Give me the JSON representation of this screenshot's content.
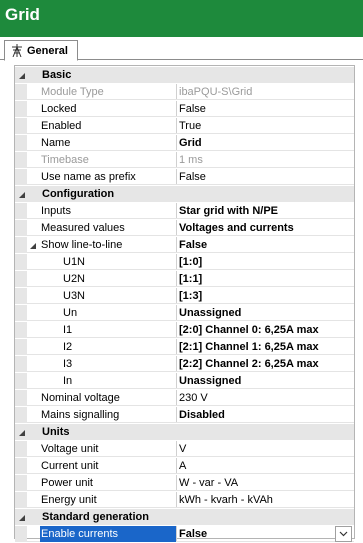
{
  "window": {
    "title": "Grid"
  },
  "tabs": [
    {
      "label": "General",
      "icon": "grid-tower-icon"
    }
  ],
  "categories": {
    "basic": "Basic",
    "configuration": "Configuration",
    "units": "Units",
    "standard_generation": "Standard generation"
  },
  "basic": {
    "module_type": {
      "name": "Module Type",
      "value": "ibaPQU-S\\Grid"
    },
    "locked": {
      "name": "Locked",
      "value": "False"
    },
    "enabled": {
      "name": "Enabled",
      "value": "True"
    },
    "name": {
      "name": "Name",
      "value": "Grid"
    },
    "timebase": {
      "name": "Timebase",
      "value": "1 ms"
    },
    "use_name_as_prefix": {
      "name": "Use name as prefix",
      "value": "False"
    }
  },
  "configuration": {
    "inputs": {
      "name": "Inputs",
      "value": "Star grid with N/PE"
    },
    "measured_values": {
      "name": "Measured values",
      "value": "Voltages and currents"
    },
    "show_line_to_line": {
      "name": "Show line-to-line",
      "value": "False"
    },
    "u1n": {
      "name": "U1N",
      "value": "[1:0]"
    },
    "u2n": {
      "name": "U2N",
      "value": "[1:1]"
    },
    "u3n": {
      "name": "U3N",
      "value": "[1:3]"
    },
    "un": {
      "name": "Un",
      "value": "Unassigned"
    },
    "i1": {
      "name": "I1",
      "value": "[2:0] Channel  0: 6,25A max"
    },
    "i2": {
      "name": "I2",
      "value": "[2:1] Channel  1: 6,25A max"
    },
    "i3": {
      "name": "I3",
      "value": "[2:2] Channel  2: 6,25A max"
    },
    "in": {
      "name": "In",
      "value": "Unassigned"
    },
    "nominal_voltage": {
      "name": "Nominal voltage",
      "value": "230 V"
    },
    "mains_signalling": {
      "name": "Mains signalling",
      "value": "Disabled"
    }
  },
  "units": {
    "voltage_unit": {
      "name": "Voltage unit",
      "value": "V"
    },
    "current_unit": {
      "name": "Current unit",
      "value": "A"
    },
    "power_unit": {
      "name": "Power unit",
      "value": "W - var - VA"
    },
    "energy_unit": {
      "name": "Energy unit",
      "value": "kWh - kvarh - kVAh"
    }
  },
  "standard_generation": {
    "enable_currents": {
      "name": "Enable currents",
      "value": "False"
    }
  },
  "colors": {
    "titlebar": "#1e8a3c",
    "selection": "#1a66c9",
    "category_bg": "#e6e6e6",
    "disabled_text": "#9a9a9a"
  }
}
